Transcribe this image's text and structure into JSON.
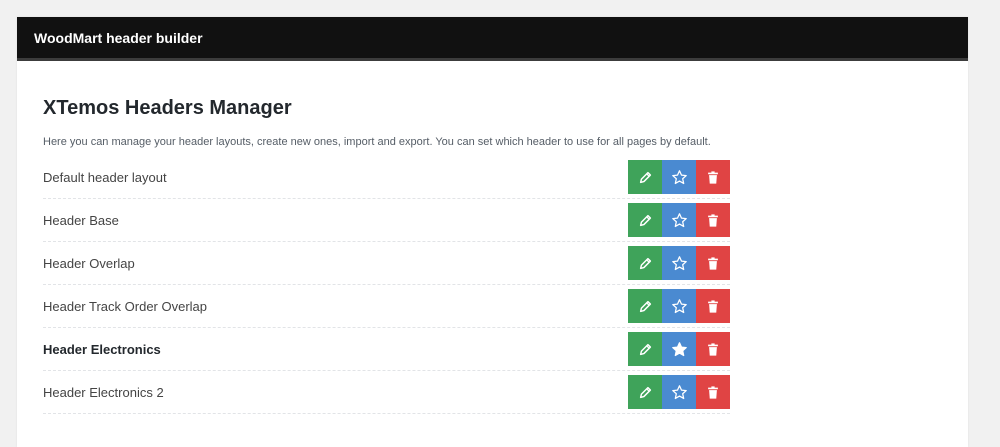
{
  "app": {
    "title": "WoodMart header builder"
  },
  "manager": {
    "heading": "XTemos Headers Manager",
    "description": "Here you can manage your header layouts, create new ones, import and export. You can set which header to use for all pages by default."
  },
  "headers": [
    {
      "label": "Default header layout",
      "is_default": false
    },
    {
      "label": "Header Base",
      "is_default": false
    },
    {
      "label": "Header Overlap",
      "is_default": false
    },
    {
      "label": "Header Track Order Overlap",
      "is_default": false
    },
    {
      "label": "Header Electronics",
      "is_default": true
    },
    {
      "label": "Header Electronics 2",
      "is_default": false
    }
  ],
  "icons": {
    "edit": "pencil-icon",
    "set_default": "star-icon",
    "delete": "trash-icon"
  },
  "colors": {
    "topbar": "#111111",
    "edit_button": "#3fa35a",
    "default_button": "#4a8ad1",
    "delete_button": "#e04444"
  }
}
